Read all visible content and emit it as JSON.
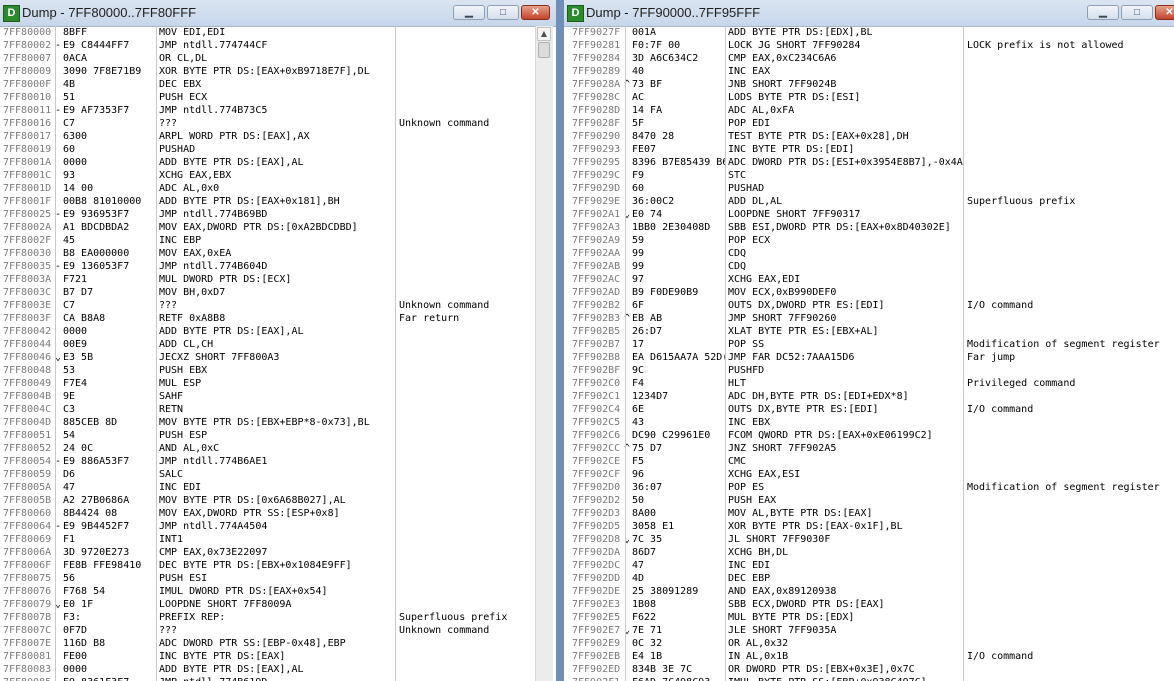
{
  "left": {
    "title": "Dump - 7FF80000..7FF80FFF",
    "buttons": {
      "minimize": "▁",
      "maximize": "□",
      "close": "✕"
    },
    "rows": [
      {
        "addr": "7FF80000",
        "mark": "",
        "hex": "8BFF",
        "disasm": "MOV EDI,EDI",
        "comment": ""
      },
      {
        "addr": "7FF80002",
        "mark": "-",
        "hex": "E9 C8444FF7",
        "disasm": "JMP ntdll.774744CF",
        "comment": ""
      },
      {
        "addr": "7FF80007",
        "mark": "",
        "hex": "0ACA",
        "disasm": "OR CL,DL",
        "comment": ""
      },
      {
        "addr": "7FF80009",
        "mark": "",
        "hex": "3090 7F8E71B9",
        "disasm": "XOR BYTE PTR DS:[EAX+0xB9718E7F],DL",
        "comment": ""
      },
      {
        "addr": "7FF8000F",
        "mark": "",
        "hex": "4B",
        "disasm": "DEC EBX",
        "comment": ""
      },
      {
        "addr": "7FF80010",
        "mark": "",
        "hex": "51",
        "disasm": "PUSH ECX",
        "comment": ""
      },
      {
        "addr": "7FF80011",
        "mark": "-",
        "hex": "E9 AF7353F7",
        "disasm": "JMP ntdll.774B73C5",
        "comment": ""
      },
      {
        "addr": "7FF80016",
        "mark": "",
        "hex": "C7",
        "disasm": "???",
        "comment": "Unknown command"
      },
      {
        "addr": "7FF80017",
        "mark": "",
        "hex": "6300",
        "disasm": "ARPL WORD PTR DS:[EAX],AX",
        "comment": ""
      },
      {
        "addr": "7FF80019",
        "mark": "",
        "hex": "60",
        "disasm": "PUSHAD",
        "comment": ""
      },
      {
        "addr": "7FF8001A",
        "mark": "",
        "hex": "0000",
        "disasm": "ADD BYTE PTR DS:[EAX],AL",
        "comment": ""
      },
      {
        "addr": "7FF8001C",
        "mark": "",
        "hex": "93",
        "disasm": "XCHG EAX,EBX",
        "comment": ""
      },
      {
        "addr": "7FF8001D",
        "mark": "",
        "hex": "14 00",
        "disasm": "ADC AL,0x0",
        "comment": ""
      },
      {
        "addr": "7FF8001F",
        "mark": "",
        "hex": "00B8 81010000",
        "disasm": "ADD BYTE PTR DS:[EAX+0x181],BH",
        "comment": ""
      },
      {
        "addr": "7FF80025",
        "mark": "-",
        "hex": "E9 936953F7",
        "disasm": "JMP ntdll.774B69BD",
        "comment": ""
      },
      {
        "addr": "7FF8002A",
        "mark": "",
        "hex": "A1 BDCDBDA2",
        "disasm": "MOV EAX,DWORD PTR DS:[0xA2BDCDBD]",
        "comment": ""
      },
      {
        "addr": "7FF8002F",
        "mark": "",
        "hex": "45",
        "disasm": "INC EBP",
        "comment": ""
      },
      {
        "addr": "7FF80030",
        "mark": "",
        "hex": "B8 EA000000",
        "disasm": "MOV EAX,0xEA",
        "comment": ""
      },
      {
        "addr": "7FF80035",
        "mark": "-",
        "hex": "E9 136053F7",
        "disasm": "JMP ntdll.774B604D",
        "comment": ""
      },
      {
        "addr": "7FF8003A",
        "mark": "",
        "hex": "F721",
        "disasm": "MUL DWORD PTR DS:[ECX]",
        "comment": ""
      },
      {
        "addr": "7FF8003C",
        "mark": "",
        "hex": "B7 D7",
        "disasm": "MOV BH,0xD7",
        "comment": ""
      },
      {
        "addr": "7FF8003E",
        "mark": "",
        "hex": "C7",
        "disasm": "???",
        "comment": "Unknown command"
      },
      {
        "addr": "7FF8003F",
        "mark": "",
        "hex": "CA B8A8",
        "disasm": "RETF 0xA8B8",
        "comment": "Far return"
      },
      {
        "addr": "7FF80042",
        "mark": "",
        "hex": "0000",
        "disasm": "ADD BYTE PTR DS:[EAX],AL",
        "comment": ""
      },
      {
        "addr": "7FF80044",
        "mark": "",
        "hex": "00E9",
        "disasm": "ADD CL,CH",
        "comment": ""
      },
      {
        "addr": "7FF80046",
        "mark": "⌄",
        "hex": "E3 5B",
        "disasm": "JECXZ SHORT 7FF800A3",
        "comment": ""
      },
      {
        "addr": "7FF80048",
        "mark": "",
        "hex": "53",
        "disasm": "PUSH EBX",
        "comment": ""
      },
      {
        "addr": "7FF80049",
        "mark": "",
        "hex": "F7E4",
        "disasm": "MUL ESP",
        "comment": ""
      },
      {
        "addr": "7FF8004B",
        "mark": "",
        "hex": "9E",
        "disasm": "SAHF",
        "comment": ""
      },
      {
        "addr": "7FF8004C",
        "mark": "",
        "hex": "C3",
        "disasm": "RETN",
        "comment": ""
      },
      {
        "addr": "7FF8004D",
        "mark": "",
        "hex": "885CEB 8D",
        "disasm": "MOV BYTE PTR DS:[EBX+EBP*8-0x73],BL",
        "comment": ""
      },
      {
        "addr": "7FF80051",
        "mark": "",
        "hex": "54",
        "disasm": "PUSH ESP",
        "comment": ""
      },
      {
        "addr": "7FF80052",
        "mark": "",
        "hex": "24 0C",
        "disasm": "AND AL,0xC",
        "comment": ""
      },
      {
        "addr": "7FF80054",
        "mark": "-",
        "hex": "E9 886A53F7",
        "disasm": "JMP ntdll.774B6AE1",
        "comment": ""
      },
      {
        "addr": "7FF80059",
        "mark": "",
        "hex": "D6",
        "disasm": "SALC",
        "comment": ""
      },
      {
        "addr": "7FF8005A",
        "mark": "",
        "hex": "47",
        "disasm": "INC EDI",
        "comment": ""
      },
      {
        "addr": "7FF8005B",
        "mark": "",
        "hex": "A2 27B0686A",
        "disasm": "MOV BYTE PTR DS:[0x6A68B027],AL",
        "comment": ""
      },
      {
        "addr": "7FF80060",
        "mark": "",
        "hex": "8B4424 08",
        "disasm": "MOV EAX,DWORD PTR SS:[ESP+0x8]",
        "comment": ""
      },
      {
        "addr": "7FF80064",
        "mark": "-",
        "hex": "E9 9B4452F7",
        "disasm": "JMP ntdll.774A4504",
        "comment": ""
      },
      {
        "addr": "7FF80069",
        "mark": "",
        "hex": "F1",
        "disasm": "INT1",
        "comment": ""
      },
      {
        "addr": "7FF8006A",
        "mark": "",
        "hex": "3D 9720E273",
        "disasm": "CMP EAX,0x73E22097",
        "comment": ""
      },
      {
        "addr": "7FF8006F",
        "mark": "",
        "hex": "FE8B FFE98410",
        "disasm": "DEC BYTE PTR DS:[EBX+0x1084E9FF]",
        "comment": ""
      },
      {
        "addr": "7FF80075",
        "mark": "",
        "hex": "56",
        "disasm": "PUSH ESI",
        "comment": ""
      },
      {
        "addr": "7FF80076",
        "mark": "",
        "hex": "F768 54",
        "disasm": "IMUL DWORD PTR DS:[EAX+0x54]",
        "comment": ""
      },
      {
        "addr": "7FF80079",
        "mark": "⌄",
        "hex": "E0 1F",
        "disasm": "LOOPDNE SHORT 7FF8009A",
        "comment": ""
      },
      {
        "addr": "7FF8007B",
        "mark": "",
        "hex": "F3:",
        "disasm": "PREFIX REP:",
        "comment": "Superfluous prefix"
      },
      {
        "addr": "7FF8007C",
        "mark": "",
        "hex": "0F7D",
        "disasm": "???",
        "comment": "Unknown command"
      },
      {
        "addr": "7FF8007E",
        "mark": "",
        "hex": "116D B8",
        "disasm": "ADC DWORD PTR SS:[EBP-0x48],EBP",
        "comment": ""
      },
      {
        "addr": "7FF80081",
        "mark": "",
        "hex": "FE00",
        "disasm": "INC BYTE PTR DS:[EAX]",
        "comment": ""
      },
      {
        "addr": "7FF80083",
        "mark": "",
        "hex": "0000",
        "disasm": "ADD BYTE PTR DS:[EAX],AL",
        "comment": ""
      },
      {
        "addr": "7FF80085",
        "mark": "-",
        "hex": "E9 8361F3F7",
        "disasm": "JMP ntdll.774B619D",
        "comment": ""
      }
    ]
  },
  "right": {
    "title": "Dump - 7FF90000..7FF95FFF",
    "buttons": {
      "minimize": "▁",
      "maximize": "□",
      "close": "✕"
    },
    "rows": [
      {
        "addr": "7FF9027F",
        "mark": "",
        "hex": "001A",
        "disasm": "ADD BYTE PTR DS:[EDX],BL",
        "comment": ""
      },
      {
        "addr": "7FF90281",
        "mark": "",
        "hex": "F0:7F 00",
        "disasm": "LOCK JG SHORT 7FF90284",
        "comment": "LOCK prefix is not allowed"
      },
      {
        "addr": "7FF90284",
        "mark": "",
        "hex": "3D A6C634C2",
        "disasm": "CMP EAX,0xC234C6A6",
        "comment": ""
      },
      {
        "addr": "7FF90289",
        "mark": "",
        "hex": "40",
        "disasm": "INC EAX",
        "comment": ""
      },
      {
        "addr": "7FF9028A",
        "mark": "^",
        "hex": "73 BF",
        "disasm": "JNB SHORT 7FF9024B",
        "comment": ""
      },
      {
        "addr": "7FF9028C",
        "mark": "",
        "hex": "AC",
        "disasm": "LODS BYTE PTR DS:[ESI]",
        "comment": ""
      },
      {
        "addr": "7FF9028D",
        "mark": "",
        "hex": "14 FA",
        "disasm": "ADC AL,0xFA",
        "comment": ""
      },
      {
        "addr": "7FF9028F",
        "mark": "",
        "hex": "5F",
        "disasm": "POP EDI",
        "comment": ""
      },
      {
        "addr": "7FF90290",
        "mark": "",
        "hex": "8470 28",
        "disasm": "TEST BYTE PTR DS:[EAX+0x28],DH",
        "comment": ""
      },
      {
        "addr": "7FF90293",
        "mark": "",
        "hex": "FE07",
        "disasm": "INC BYTE PTR DS:[EDI]",
        "comment": ""
      },
      {
        "addr": "7FF90295",
        "mark": "",
        "hex": "8396 B7E85439 B6",
        "disasm": "ADC DWORD PTR DS:[ESI+0x3954E8B7],-0x4A",
        "comment": ""
      },
      {
        "addr": "7FF9029C",
        "mark": "",
        "hex": "F9",
        "disasm": "STC",
        "comment": ""
      },
      {
        "addr": "7FF9029D",
        "mark": "",
        "hex": "60",
        "disasm": "PUSHAD",
        "comment": ""
      },
      {
        "addr": "7FF9029E",
        "mark": "",
        "hex": "36:00C2",
        "disasm": "ADD DL,AL",
        "comment": "Superfluous prefix"
      },
      {
        "addr": "7FF902A1",
        "mark": "⌄",
        "hex": "E0 74",
        "disasm": "LOOPDNE SHORT 7FF90317",
        "comment": ""
      },
      {
        "addr": "7FF902A3",
        "mark": "",
        "hex": "1BB0 2E30408D",
        "disasm": "SBB ESI,DWORD PTR DS:[EAX+0x8D40302E]",
        "comment": ""
      },
      {
        "addr": "7FF902A9",
        "mark": "",
        "hex": "59",
        "disasm": "POP ECX",
        "comment": ""
      },
      {
        "addr": "7FF902AA",
        "mark": "",
        "hex": "99",
        "disasm": "CDQ",
        "comment": ""
      },
      {
        "addr": "7FF902AB",
        "mark": "",
        "hex": "99",
        "disasm": "CDQ",
        "comment": ""
      },
      {
        "addr": "7FF902AC",
        "mark": "",
        "hex": "97",
        "disasm": "XCHG EAX,EDI",
        "comment": ""
      },
      {
        "addr": "7FF902AD",
        "mark": "",
        "hex": "B9 F0DE90B9",
        "disasm": "MOV ECX,0xB990DEF0",
        "comment": ""
      },
      {
        "addr": "7FF902B2",
        "mark": "",
        "hex": "6F",
        "disasm": "OUTS DX,DWORD PTR ES:[EDI]",
        "comment": "I/O command"
      },
      {
        "addr": "7FF902B3",
        "mark": "^",
        "hex": "EB AB",
        "disasm": "JMP SHORT 7FF90260",
        "comment": ""
      },
      {
        "addr": "7FF902B5",
        "mark": "",
        "hex": "26:D7",
        "disasm": "XLAT BYTE PTR ES:[EBX+AL]",
        "comment": ""
      },
      {
        "addr": "7FF902B7",
        "mark": "",
        "hex": "17",
        "disasm": "POP SS",
        "comment": "Modification of segment register"
      },
      {
        "addr": "7FF902B8",
        "mark": "",
        "hex": "EA D615AA7A 52D(",
        "disasm": "JMP FAR DC52:7AAA15D6",
        "comment": "Far jump"
      },
      {
        "addr": "7FF902BF",
        "mark": "",
        "hex": "9C",
        "disasm": "PUSHFD",
        "comment": ""
      },
      {
        "addr": "7FF902C0",
        "mark": "",
        "hex": "F4",
        "disasm": "HLT",
        "comment": "Privileged command"
      },
      {
        "addr": "7FF902C1",
        "mark": "",
        "hex": "1234D7",
        "disasm": "ADC DH,BYTE PTR DS:[EDI+EDX*8]",
        "comment": ""
      },
      {
        "addr": "7FF902C4",
        "mark": "",
        "hex": "6E",
        "disasm": "OUTS DX,BYTE PTR ES:[EDI]",
        "comment": "I/O command"
      },
      {
        "addr": "7FF902C5",
        "mark": "",
        "hex": "43",
        "disasm": "INC EBX",
        "comment": ""
      },
      {
        "addr": "7FF902C6",
        "mark": "",
        "hex": "DC90 C29961E0",
        "disasm": "FCOM QWORD PTR DS:[EAX+0xE06199C2]",
        "comment": ""
      },
      {
        "addr": "7FF902CC",
        "mark": "^",
        "hex": "75 D7",
        "disasm": "JNZ SHORT 7FF902A5",
        "comment": ""
      },
      {
        "addr": "7FF902CE",
        "mark": "",
        "hex": "F5",
        "disasm": "CMC",
        "comment": ""
      },
      {
        "addr": "7FF902CF",
        "mark": "",
        "hex": "96",
        "disasm": "XCHG EAX,ESI",
        "comment": ""
      },
      {
        "addr": "7FF902D0",
        "mark": "",
        "hex": "36:07",
        "disasm": "POP ES",
        "comment": "Modification of segment register"
      },
      {
        "addr": "7FF902D2",
        "mark": "",
        "hex": "50",
        "disasm": "PUSH EAX",
        "comment": ""
      },
      {
        "addr": "7FF902D3",
        "mark": "",
        "hex": "8A00",
        "disasm": "MOV AL,BYTE PTR DS:[EAX]",
        "comment": ""
      },
      {
        "addr": "7FF902D5",
        "mark": "",
        "hex": "3058 E1",
        "disasm": "XOR BYTE PTR DS:[EAX-0x1F],BL",
        "comment": ""
      },
      {
        "addr": "7FF902D8",
        "mark": "⌄",
        "hex": "7C 35",
        "disasm": "JL SHORT 7FF9030F",
        "comment": ""
      },
      {
        "addr": "7FF902DA",
        "mark": "",
        "hex": "86D7",
        "disasm": "XCHG BH,DL",
        "comment": ""
      },
      {
        "addr": "7FF902DC",
        "mark": "",
        "hex": "47",
        "disasm": "INC EDI",
        "comment": ""
      },
      {
        "addr": "7FF902DD",
        "mark": "",
        "hex": "4D",
        "disasm": "DEC EBP",
        "comment": ""
      },
      {
        "addr": "7FF902DE",
        "mark": "",
        "hex": "25 38091289",
        "disasm": "AND EAX,0x89120938",
        "comment": ""
      },
      {
        "addr": "7FF902E3",
        "mark": "",
        "hex": "1B08",
        "disasm": "SBB ECX,DWORD PTR DS:[EAX]",
        "comment": ""
      },
      {
        "addr": "7FF902E5",
        "mark": "",
        "hex": "F622",
        "disasm": "MUL BYTE PTR DS:[EDX]",
        "comment": ""
      },
      {
        "addr": "7FF902E7",
        "mark": "⌄",
        "hex": "7E 71",
        "disasm": "JLE SHORT 7FF9035A",
        "comment": ""
      },
      {
        "addr": "7FF902E9",
        "mark": "",
        "hex": "0C 32",
        "disasm": "OR AL,0x32",
        "comment": ""
      },
      {
        "addr": "7FF902EB",
        "mark": "",
        "hex": "E4 1B",
        "disasm": "IN AL,0x1B",
        "comment": "I/O command"
      },
      {
        "addr": "7FF902ED",
        "mark": "",
        "hex": "834B 3E 7C",
        "disasm": "OR DWORD PTR DS:[EBX+0x3E],0x7C",
        "comment": ""
      },
      {
        "addr": "7FF902F1",
        "mark": "",
        "hex": "F6AD 7C498C93",
        "disasm": "IMUL BYTE PTR SS:[EBP+0x938C497C]",
        "comment": ""
      }
    ]
  }
}
